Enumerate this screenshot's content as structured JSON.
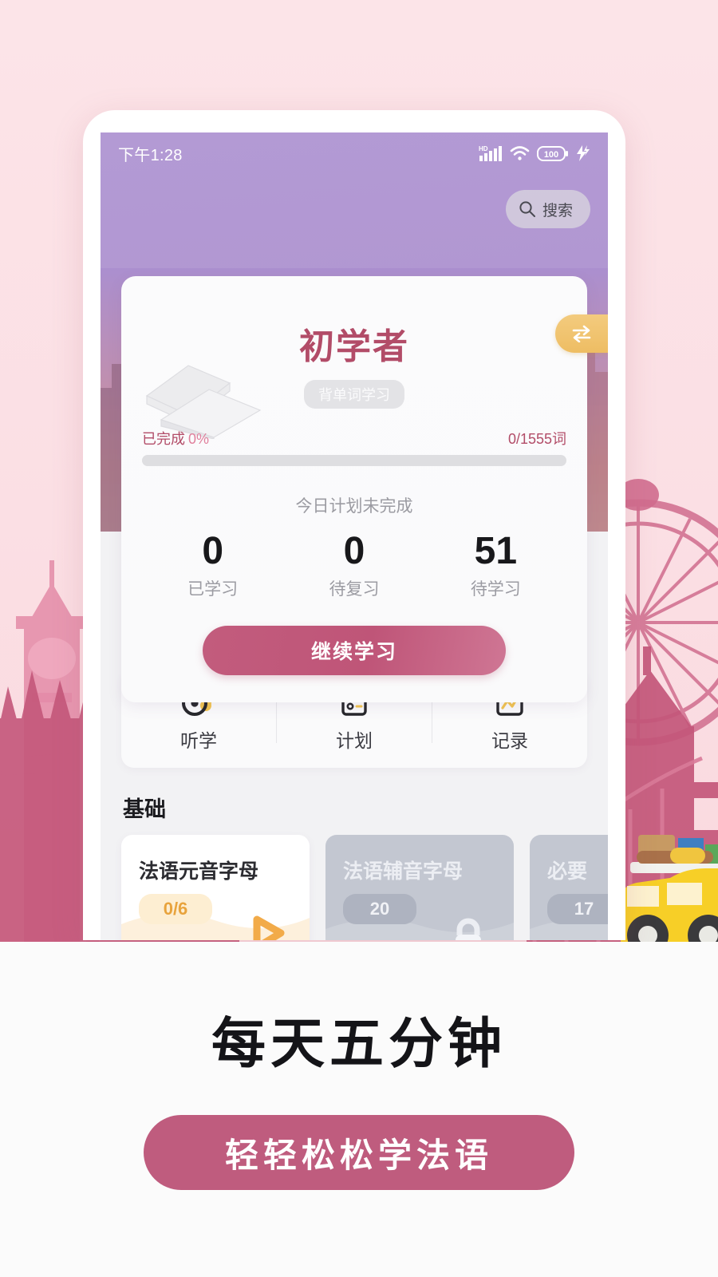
{
  "status_bar": {
    "time": "下午1:28",
    "icons": [
      "hd-signal-icon",
      "wifi-icon",
      "battery-icon",
      "charging-bolt-icon"
    ],
    "battery_level": "100"
  },
  "search": {
    "label": "搜索",
    "icon": "search-icon"
  },
  "hero_card": {
    "level_title": "初学者",
    "mode_badge": "背单词学习",
    "swap_icon": "swap-arrows-icon",
    "progress": {
      "label": "已完成",
      "percent_text": "0%",
      "percent_value": 0,
      "word_count": "0/1555词"
    },
    "plan_status": "今日计划未完成",
    "stats": [
      {
        "value": "0",
        "label": "已学习"
      },
      {
        "value": "0",
        "label": "待复习"
      },
      {
        "value": "51",
        "label": "待学习"
      }
    ],
    "cta_label": "继续学习"
  },
  "quick_actions": [
    {
      "label": "听学",
      "icon": "vinyl-music-icon"
    },
    {
      "label": "计划",
      "icon": "checklist-icon"
    },
    {
      "label": "记录",
      "icon": "calendar-chart-icon"
    }
  ],
  "section": {
    "title": "基础",
    "lessons": [
      {
        "name": "法语元音字母",
        "count": "0/6",
        "state": "active",
        "icon": "play-icon"
      },
      {
        "name": "法语辅音字母",
        "count": "20",
        "state": "locked",
        "icon": "lock-icon"
      },
      {
        "name": "必要",
        "count": "17",
        "state": "locked",
        "icon": "lock-icon"
      }
    ]
  },
  "promo": {
    "headline": "每天五分钟",
    "button_label": "轻轻松松学法语"
  },
  "colors": {
    "brand_pink": "#bf5c7e",
    "accent_maroon": "#b24c68",
    "accent_yellow": "#eebd63",
    "hero_purple": "#b197d2",
    "page_bg": "#fce4e8"
  }
}
